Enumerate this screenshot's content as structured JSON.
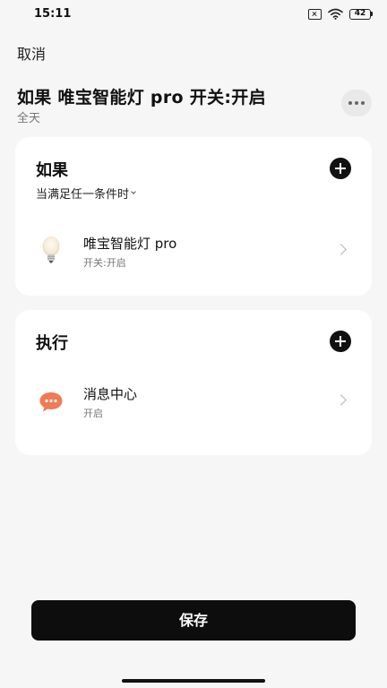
{
  "status_bar": {
    "time": "15:11",
    "battery": "42",
    "icons": [
      "sim-off-icon",
      "wifi-icon",
      "battery-icon"
    ]
  },
  "header": {
    "cancel_label": "取消",
    "title": "如果 唯宝智能灯 pro 开关:开启",
    "subtitle": "全天",
    "more_icon": "more-dots-icon"
  },
  "if_section": {
    "title": "如果",
    "mode_label": "当满足任一条件时",
    "add_icon": "plus-circle-icon",
    "conditions": [
      {
        "icon": "light-bulb-icon",
        "name": "唯宝智能灯 pro",
        "status": "开关:开启"
      }
    ]
  },
  "then_section": {
    "title": "执行",
    "add_icon": "plus-circle-icon",
    "actions": [
      {
        "icon": "message-bubble-icon",
        "name": "消息中心",
        "status": "开启"
      }
    ]
  },
  "footer": {
    "save_label": "保存"
  },
  "colors": {
    "background": "#f6f6f6",
    "card": "#ffffff",
    "primary_button": "#0d0d0d",
    "message_icon": "#f07a55"
  }
}
